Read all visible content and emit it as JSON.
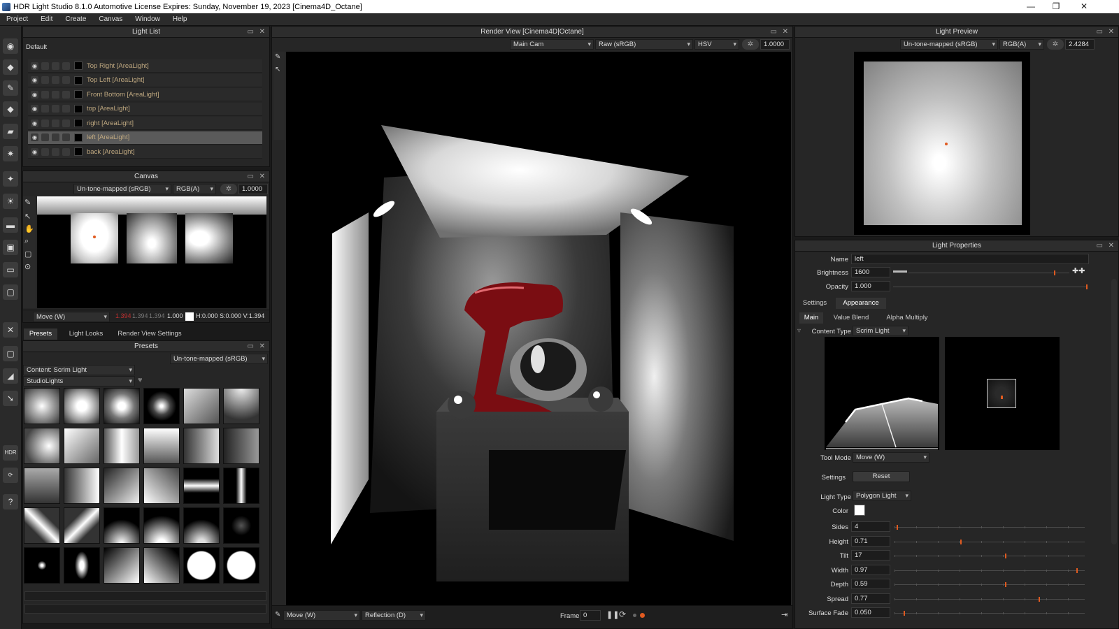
{
  "titlebar": {
    "title": "HDR Light Studio 8.1.0  Automotive License Expires: Sunday, November 19, 2023  [Cinema4D_Octane]"
  },
  "menu": [
    "Project",
    "Edit",
    "Create",
    "Canvas",
    "Window",
    "Help"
  ],
  "light_list": {
    "title": "Light List",
    "group": "Default",
    "items": [
      {
        "name": "Top Right [AreaLight]"
      },
      {
        "name": "Top Left [AreaLight]"
      },
      {
        "name": "Front Bottom [AreaLight]"
      },
      {
        "name": "top [AreaLight]"
      },
      {
        "name": "right [AreaLight]"
      },
      {
        "name": "left [AreaLight]",
        "selected": true
      },
      {
        "name": "back [AreaLight]"
      }
    ]
  },
  "canvas": {
    "title": "Canvas",
    "tonemap": "Un-tone-mapped (sRGB)",
    "channel": "RGB(A)",
    "exposure": "1.0000",
    "tool_mode": "Move (W)",
    "readout_r": "1.394",
    "readout_g": "1.394",
    "readout_b": "1.394",
    "readout_a": "1.000",
    "hsv": "H:0.000 S:0.000 V:1.394"
  },
  "bottom_tabs": [
    "Presets",
    "Light Looks",
    "Render View Settings"
  ],
  "presets": {
    "title": "Presets",
    "tonemap": "Un-tone-mapped (sRGB)",
    "content": "Content: Scrim Light",
    "library": "StudioLights"
  },
  "render_view": {
    "title": "Render View [Cinema4D|Octane]",
    "camera": "Main Cam",
    "colorspace": "Raw (sRGB)",
    "mode": "HSV",
    "exposure": "1.0000",
    "tool_mode": "Move (W)",
    "reflection": "Reflection (D)",
    "frame_label": "Frame",
    "frame": "0"
  },
  "light_preview": {
    "title": "Light Preview",
    "tonemap": "Un-tone-mapped (sRGB)",
    "channel": "RGB(A)",
    "exposure": "2.4284"
  },
  "light_properties": {
    "title": "Light Properties",
    "name_label": "Name",
    "name": "left",
    "brightness_label": "Brightness",
    "brightness": "1600",
    "opacity_label": "Opacity",
    "opacity": "1.000",
    "tabs": [
      "Settings",
      "Appearance"
    ],
    "subtabs": [
      "Main",
      "Value Blend",
      "Alpha Multiply"
    ],
    "content_type_label": "Content Type",
    "content_type": "Scrim Light",
    "tool_mode_label": "Tool Mode",
    "tool_mode": "Move (W)",
    "settings_label": "Settings",
    "reset_label": "Reset",
    "light_type_label": "Light Type",
    "light_type": "Polygon Light",
    "color_label": "Color",
    "params": [
      {
        "label": "Sides",
        "value": "4",
        "level": 0.01
      },
      {
        "label": "Height",
        "value": "0.71",
        "level": 0.35
      },
      {
        "label": "Tilt",
        "value": "17",
        "level": 0.59
      },
      {
        "label": "Width",
        "value": "0.97",
        "level": 0.97
      },
      {
        "label": "Depth",
        "value": "0.59",
        "level": 0.59
      },
      {
        "label": "Spread",
        "value": "0.77",
        "level": 0.77
      },
      {
        "label": "Surface Fade",
        "value": "0.050",
        "level": 0.05
      }
    ]
  },
  "colors": {
    "accent": "#e05a20",
    "panel": "#262626",
    "title": "#2d2d2d"
  }
}
